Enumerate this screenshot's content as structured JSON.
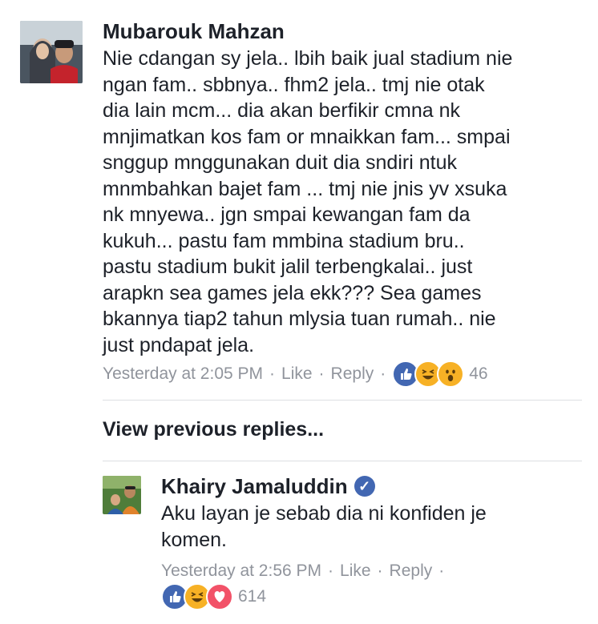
{
  "comment": {
    "author": "Mubarouk Mahzan",
    "text": "Nie cdangan sy jela.. lbih baik jual stadium nie\nngan fam.. sbbnya.. fhm2 jela.. tmj nie otak\ndia lain  mcm... dia akan berfikir cmna nk\nmnjimatkan kos fam or mnaikkan fam... smpai\nsnggup mnggunakan duit dia sndiri ntuk\nmnmbahkan bajet fam ... tmj nie jnis yv xsuka\nnk mnyewa.. jgn smpai kewangan fam da\nkukuh... pastu fam mmbina stadium bru..\npastu stadium bukit jalil terbengkalai.. just\narapkn sea games jela ekk??? Sea games\nbkannya tiap2 tahun mlysia tuan rumah.. nie\njust pndapat jela.",
    "time": "Yesterday at 2:05 PM",
    "like_label": "Like",
    "reply_label": "Reply",
    "reaction_count": "46",
    "reactions": [
      "like-icon",
      "haha-icon",
      "wow-icon"
    ]
  },
  "view_previous_label": "View previous replies...",
  "reply": {
    "author": "Khairy Jamaluddin",
    "verified_icon": "verified-badge-icon",
    "text": "Aku layan je sebab dia ni konfiden je\nkomen.",
    "time": "Yesterday at 2:56 PM",
    "like_label": "Like",
    "reply_label": "Reply",
    "reaction_count": "614",
    "reactions": [
      "like-icon",
      "haha-icon",
      "love-icon"
    ]
  },
  "colors": {
    "text": "#1d2129",
    "meta": "#90949c",
    "like_blue": "#4267b2",
    "haha_yellow": "#f7b125",
    "love_red": "#f25268",
    "divider": "#dddfe2"
  }
}
